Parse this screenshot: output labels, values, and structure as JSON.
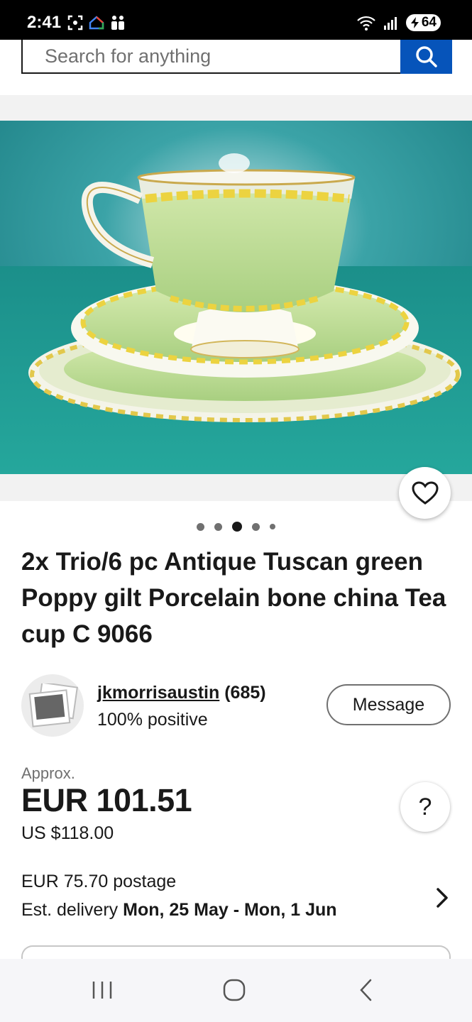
{
  "status_bar": {
    "time": "2:41",
    "battery": "64",
    "icons": [
      "screenshot-icon",
      "home-app-icon",
      "family-icon",
      "wifi-icon",
      "signal-icon",
      "battery-icon"
    ]
  },
  "search": {
    "placeholder": "Search for anything"
  },
  "gallery": {
    "total_images": 5,
    "current_index": 3
  },
  "listing": {
    "title": "2x Trio/6 pc Antique Tuscan green Poppy gilt Porcelain bone china Tea cup C 9066"
  },
  "seller": {
    "name": "jkmorrisaustin",
    "feedback_count": "(685)",
    "positive": "100% positive",
    "message_label": "Message"
  },
  "price": {
    "approx_label": "Approx.",
    "converted": "EUR 101.51",
    "original": "US $118.00",
    "help_label": "?"
  },
  "shipping": {
    "postage": "EUR 75.70 postage",
    "delivery_label": "Est. delivery",
    "delivery_range": "Mon, 25 May - Mon, 1 Jun"
  },
  "colors": {
    "accent": "#0654ba",
    "text": "#191919",
    "muted": "#707070"
  }
}
